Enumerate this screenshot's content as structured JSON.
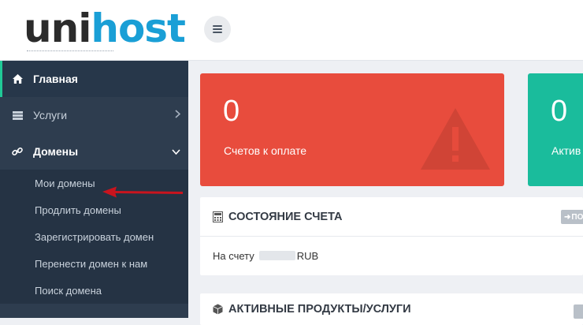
{
  "header": {
    "logo_part1": "uni",
    "logo_part2": "host"
  },
  "sidebar": {
    "items": [
      {
        "label": "Главная"
      },
      {
        "label": "Услуги"
      },
      {
        "label": "Домены"
      }
    ],
    "domains_submenu": [
      {
        "label": "Мои домены"
      },
      {
        "label": "Продлить домены"
      },
      {
        "label": "Зарегистрировать домен"
      },
      {
        "label": "Перенести домен к нам"
      },
      {
        "label": "Поиск домена"
      }
    ]
  },
  "stats": [
    {
      "value": "0",
      "label": "Счетов к оплате",
      "color": "#e84c3d"
    },
    {
      "value": "0",
      "label": "Актив",
      "color": "#1abc9c"
    }
  ],
  "balance_panel": {
    "title": "СОСТОЯНИЕ СЧЕТА",
    "button_label": "ПО",
    "text_prefix": "На счету",
    "currency": "RUB"
  },
  "products_panel": {
    "title": "АКТИВНЫЕ ПРОДУКТЫ/УСЛУГИ"
  },
  "colors": {
    "sidebar": "#2e3d4f",
    "accent": "#1a9fd6",
    "annotation_arrow": "#c9141e"
  }
}
